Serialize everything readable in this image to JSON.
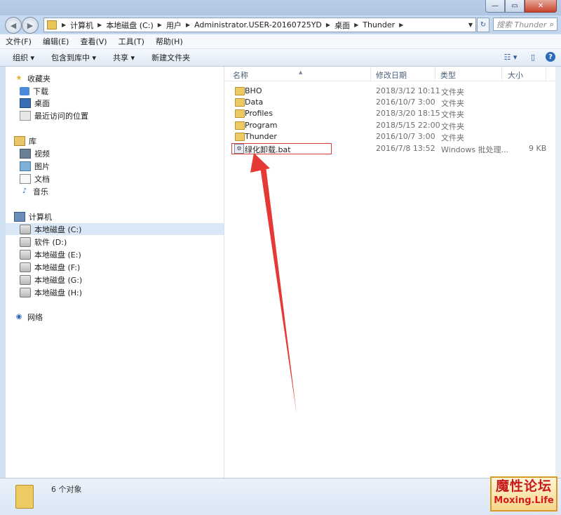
{
  "window": {
    "minimize_label": "—",
    "maximize_label": "▭",
    "close_label": "✕"
  },
  "nav": {
    "back_icon": "◀",
    "forward_icon": "▶",
    "breadcrumbs": [
      "计算机",
      "本地磁盘 (C:)",
      "用户",
      "Administrator.USER-20160725YD",
      "桌面",
      "Thunder"
    ],
    "refresh_icon": "↻",
    "search_placeholder": "搜索 Thunder",
    "search_icon": "⌕"
  },
  "menu": [
    "文件(F)",
    "编辑(E)",
    "查看(V)",
    "工具(T)",
    "帮助(H)"
  ],
  "toolbar": {
    "organize": "组织 ▾",
    "include_library": "包含到库中 ▾",
    "share": "共享 ▾",
    "new_folder": "新建文件夹",
    "view_icon": "☷ ▾",
    "preview_icon": "▯",
    "help_icon": "?"
  },
  "sidebar": {
    "favorites": "收藏夹",
    "fav_items": [
      "下载",
      "桌面",
      "最近访问的位置"
    ],
    "libraries": "库",
    "lib_items": [
      "视频",
      "图片",
      "文档",
      "音乐"
    ],
    "computer": "计算机",
    "drives": [
      "本地磁盘 (C:)",
      "软件 (D:)",
      "本地磁盘 (E:)",
      "本地磁盘 (F:)",
      "本地磁盘 (G:)",
      "本地磁盘 (H:)"
    ],
    "network": "网络"
  },
  "columns": {
    "name": "名称",
    "date": "修改日期",
    "type": "类型",
    "size": "大小"
  },
  "files": [
    {
      "name": "BHO",
      "date": "2018/3/12 10:11",
      "type": "文件夹",
      "size": ""
    },
    {
      "name": "Data",
      "date": "2016/10/7 3:00",
      "type": "文件夹",
      "size": ""
    },
    {
      "name": "Profiles",
      "date": "2018/3/20 18:15",
      "type": "文件夹",
      "size": ""
    },
    {
      "name": "Program",
      "date": "2018/5/15 22:00",
      "type": "文件夹",
      "size": ""
    },
    {
      "name": "Thunder",
      "date": "2016/10/7 3:00",
      "type": "文件夹",
      "size": ""
    },
    {
      "name": "绿化卸载.bat",
      "date": "2016/7/8 13:52",
      "type": "Windows 批处理...",
      "size": "9 KB"
    }
  ],
  "status": {
    "count": "6 个对象"
  },
  "watermark": {
    "line1": "魔性论坛",
    "line2": "Moxing.Life"
  },
  "colors": {
    "annotation_red": "#e53935",
    "folder_yellow": "#eecb62"
  }
}
